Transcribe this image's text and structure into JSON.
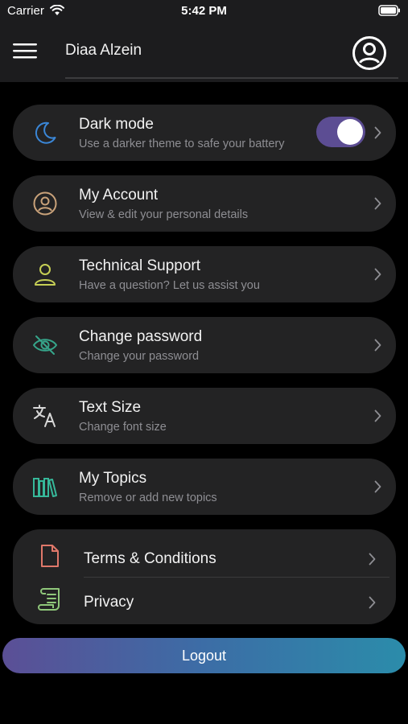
{
  "status_bar": {
    "carrier": "Carrier",
    "time": "5:42 PM"
  },
  "header": {
    "username": "Diaa Alzein"
  },
  "settings": [
    {
      "title": "Dark mode",
      "subtitle": "Use a darker theme to safe your battery",
      "icon": "moon-icon",
      "icon_color": "#3a86d6",
      "toggle_on": true
    },
    {
      "title": "My Account",
      "subtitle": "View & edit your personal details",
      "icon": "account-circle-icon",
      "icon_color": "#c9a27a"
    },
    {
      "title": "Technical Support",
      "subtitle": "Have a question? Let us assist you",
      "icon": "person-icon",
      "icon_color": "#c6cf55"
    },
    {
      "title": "Change password",
      "subtitle": "Change your password",
      "icon": "eye-off-icon",
      "icon_color": "#36a58a"
    },
    {
      "title": "Text Size",
      "subtitle": "Change font size",
      "icon": "translate-icon",
      "icon_color": "#d8d8d8"
    },
    {
      "title": "My Topics",
      "subtitle": "Remove or add new topics",
      "icon": "books-icon",
      "icon_color": "#36b89a"
    }
  ],
  "legal": [
    {
      "label": "Terms & Conditions",
      "icon": "document-icon",
      "icon_color": "#e0786a"
    },
    {
      "label": "Privacy",
      "icon": "scroll-icon",
      "icon_color": "#8fc77a"
    }
  ],
  "logout_label": "Logout",
  "colors": {
    "toggle_track": "#5c4d93",
    "logout_gradient": [
      "#5b4f96",
      "#2b8caa"
    ]
  }
}
